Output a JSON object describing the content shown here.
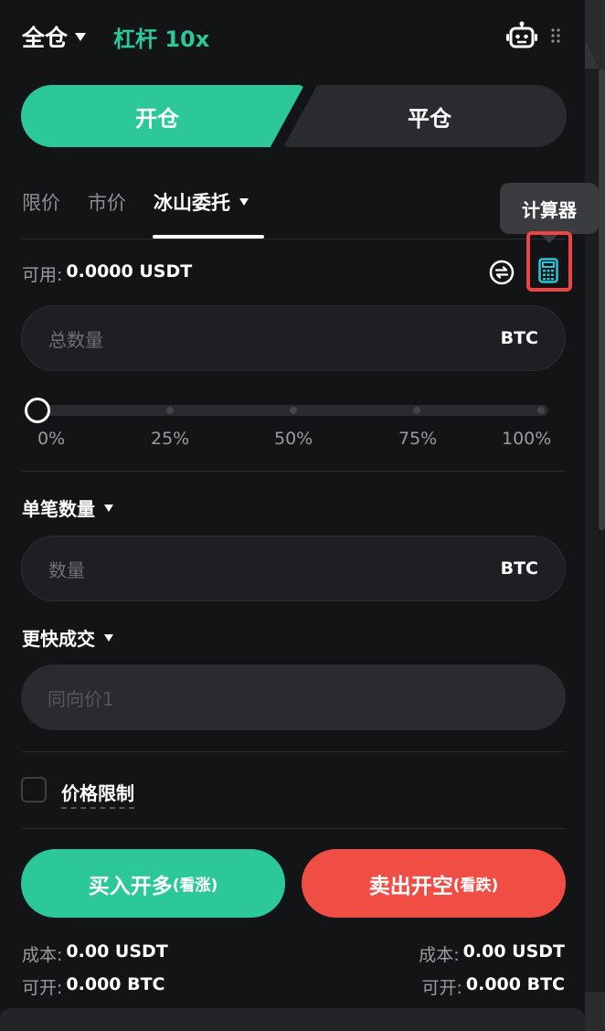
{
  "header": {
    "margin_mode": "全仓",
    "leverage": "杠杆 10x"
  },
  "side_tabs": {
    "open": "开仓",
    "close": "平仓"
  },
  "order_types": [
    {
      "label": "限价",
      "active": false
    },
    {
      "label": "市价",
      "active": false
    },
    {
      "label": "冰山委托",
      "active": true
    }
  ],
  "tooltip": "计算器",
  "available": {
    "label": "可用:",
    "value": "0.0000 USDT"
  },
  "total_qty": {
    "placeholder": "总数量",
    "unit": "BTC"
  },
  "slider": {
    "value_pct": 0,
    "marks": [
      "0%",
      "25%",
      "50%",
      "75%",
      "100%"
    ]
  },
  "single_qty": {
    "label": "单笔数量",
    "placeholder": "数量",
    "unit": "BTC"
  },
  "faster_fill": {
    "label": "更快成交",
    "value": "同向价1"
  },
  "price_limit": {
    "label": "价格限制",
    "checked": false
  },
  "actions": {
    "buy_main": "买入开多",
    "buy_sub": "(看涨)",
    "sell_main": "卖出开空",
    "sell_sub": "(看跌)"
  },
  "buy_info": {
    "cost_label": "成本:",
    "cost_value": "0.00 USDT",
    "avail_label": "可开:",
    "avail_value": "0.000 BTC"
  },
  "sell_info": {
    "cost_label": "成本:",
    "cost_value": "0.00 USDT",
    "avail_label": "可开:",
    "avail_value": "0.000 BTC"
  },
  "colors": {
    "accent_green": "#2cc89a",
    "accent_red": "#f04d45",
    "highlight": "#ef4444"
  },
  "icons": {
    "robot": "robot-icon",
    "more": "drag-dots-icon",
    "swap": "swap-icon",
    "calculator": "calculator-icon"
  }
}
